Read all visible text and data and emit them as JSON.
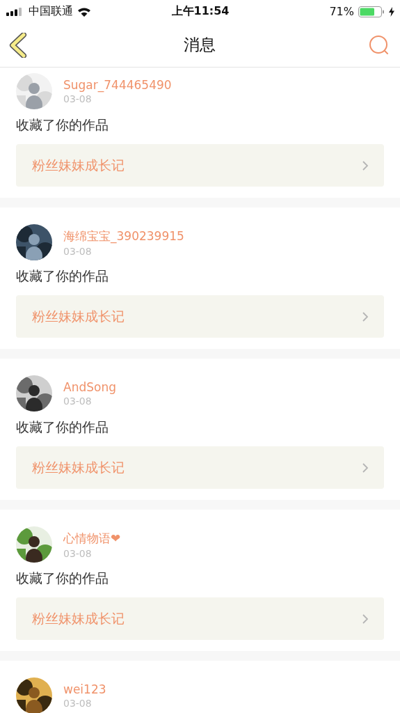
{
  "status_bar": {
    "carrier": "中国联通",
    "time": "上午11:54",
    "battery": "71%"
  },
  "nav": {
    "title": "消息"
  },
  "messages": [
    {
      "user": "Sugar_744465490",
      "date": "03-08",
      "action": "收藏了你的作品",
      "work": "粉丝妹妹成长记"
    },
    {
      "user": "海绵宝宝_390239915",
      "date": "03-08",
      "action": "收藏了你的作品",
      "work": "粉丝妹妹成长记"
    },
    {
      "user": "AndSong",
      "date": "03-08",
      "action": "收藏了你的作品",
      "work": "粉丝妹妹成长记"
    },
    {
      "user": "心情物语❤",
      "date": "03-08",
      "action": "收藏了你的作品",
      "work": "粉丝妹妹成长记"
    },
    {
      "user": "wei123",
      "date": "03-08"
    }
  ]
}
